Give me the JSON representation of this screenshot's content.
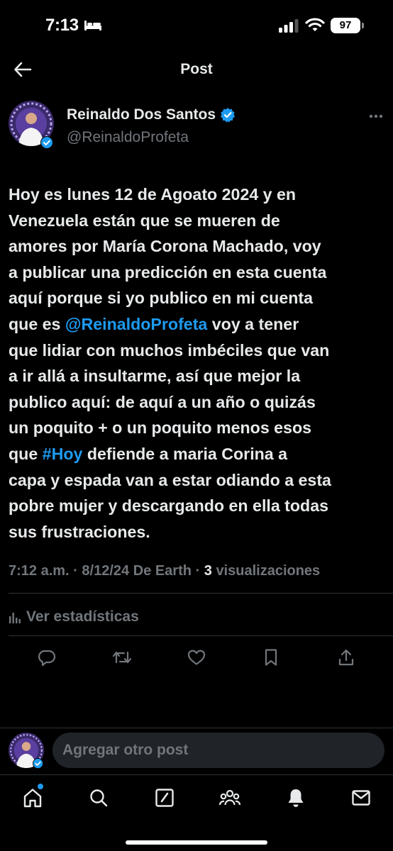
{
  "status_bar": {
    "time": "7:13",
    "battery": "97"
  },
  "header": {
    "title": "Post"
  },
  "author": {
    "display_name": "Reinaldo Dos Santos",
    "handle": "@ReinaldoProfeta",
    "verified": true
  },
  "post": {
    "text_lines": [
      "Hoy es lunes 12 de Agoato 2024 y en",
      "Venezuela están que se mueren de",
      "amores por María Corona Machado, voy",
      "a publicar una predicción en esta cuenta",
      "aquí porque si yo publico en mi cuenta",
      "voy a tener",
      "que lidiar con muchos imbéciles que van",
      "a ir allá a insultarme, así que mejor la",
      "publico aquí: de aquí a un año o quizás",
      "un poquito + o un poquito menos esos",
      "defiende a maria Corina a",
      "capa y espada van a estar odiando a esta",
      "pobre mujer y descargando en ella todas",
      "sus frustraciones."
    ],
    "line6_prefix": "que es ",
    "mention": "@ReinaldoProfeta",
    "line11_prefix": "que ",
    "hashtag": "#Hoy"
  },
  "meta": {
    "time": "7:12 a.m.",
    "sep1": "·",
    "date": "8/12/24",
    "source": "De Earth",
    "sep2": "·",
    "views_count": "3",
    "views_label": "visualizaciones"
  },
  "stats_link": {
    "label": "Ver estadísticas"
  },
  "reply": {
    "placeholder": "Agregar otro post"
  },
  "colors": {
    "accent": "#1d9bf0",
    "background": "#000000",
    "secondary_text": "#71767b",
    "divider": "#2f3336"
  },
  "icons": [
    "back-arrow-icon",
    "more-dots-icon",
    "verified-badge-icon",
    "bar-chart-icon",
    "reply-icon",
    "repost-icon",
    "like-icon",
    "bookmark-icon",
    "share-icon",
    "home-icon",
    "search-icon",
    "compose-icon",
    "communities-icon",
    "notifications-icon",
    "messages-icon"
  ]
}
